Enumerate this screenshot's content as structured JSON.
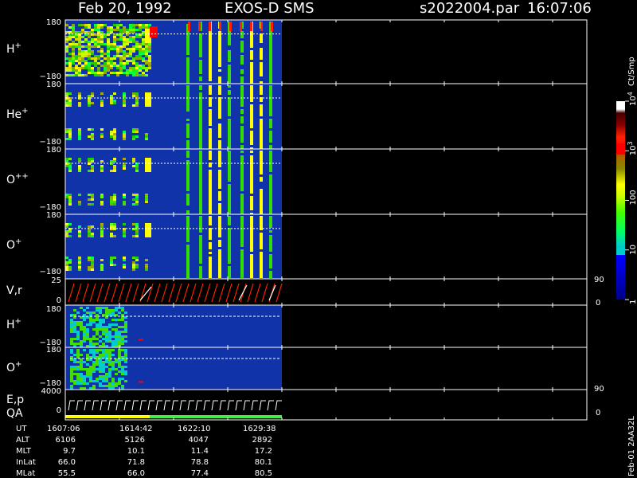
{
  "header": {
    "date": "Feb 20, 1992",
    "instrument": "EXOS-D SMS",
    "file": "s2022004.par",
    "time": "16:07:06"
  },
  "colorbar": {
    "unit": "Ct/Smp",
    "ticks": [
      {
        "label": "1",
        "value": 1
      },
      {
        "label": "10",
        "value": 10
      },
      {
        "label": "100",
        "value": 100
      },
      {
        "label": "10",
        "sup": "3",
        "value": 1000
      },
      {
        "label": "10",
        "sup": "4",
        "value": 10000
      }
    ],
    "colors": [
      "#0000ff",
      "#0011cc",
      "#00aacc",
      "#00ffff",
      "#00ffaa",
      "#00ff44",
      "#22ff00",
      "#88ff00",
      "#ffff00",
      "#cccc00",
      "#aaaa00",
      "#887700",
      "#aa6600",
      "#ff0000",
      "#cc0000",
      "#990000",
      "#770000",
      "#ffffff"
    ]
  },
  "time_axis": {
    "ticks": [
      "1607:06",
      "1614:42",
      "1622:10",
      "1629:38"
    ]
  },
  "ephemeris": [
    {
      "label": "UT",
      "values": []
    },
    {
      "label": "ALT",
      "values": [
        "6106",
        "5126",
        "4047",
        "2892"
      ]
    },
    {
      "label": "MLT",
      "values": [
        "9.7",
        "10.1",
        "11.4",
        "17.2"
      ]
    },
    {
      "label": "InLat",
      "values": [
        "66.0",
        "71.8",
        "78.8",
        "80.1"
      ]
    },
    {
      "label": "MLat",
      "values": [
        "55.5",
        "66.0",
        "77.4",
        "80.5"
      ]
    }
  ],
  "side_note": "Feb-01 2AA32L",
  "panels": {
    "hplus": {
      "label": "H",
      "sup": "+",
      "ymax": "180",
      "ymin": "−180"
    },
    "heplus": {
      "label": "He",
      "sup": "+",
      "ymax": "180",
      "ymin": "−180"
    },
    "opp": {
      "label": "O",
      "sup": "++",
      "ymax": "180",
      "ymin": "−180"
    },
    "oplus": {
      "label": "O",
      "sup": "+",
      "ymax": "180",
      "ymin": "−180"
    },
    "vr": {
      "label": "V,r",
      "ymax": "25",
      "ymin": "0",
      "rmax": "90",
      "rmin": "0"
    },
    "hplus2": {
      "label": "H",
      "sup": "+",
      "ymax": "180",
      "ymin": "−180"
    },
    "oplus2": {
      "label": "O",
      "sup": "+",
      "ymax": "180",
      "ymin": "−180"
    },
    "ep": {
      "label": "E,p",
      "label2": "QA",
      "ymax": "4000",
      "ymin": "0",
      "rmax": "90",
      "rmin": "0"
    }
  },
  "chart_data": {
    "type": "heatmap",
    "title": "Feb 20, 1992 EXOS-D SMS",
    "x": [
      "1607:06",
      "1614:42",
      "1622:10",
      "1629:38"
    ],
    "colorbar_label": "Ct/Smp",
    "colorbar_range": [
      1,
      10000
    ],
    "colorbar_scale": "log",
    "series": [
      {
        "name": "H+",
        "ylim": [
          -180,
          180
        ]
      },
      {
        "name": "He+",
        "ylim": [
          -180,
          180
        ]
      },
      {
        "name": "O++",
        "ylim": [
          -180,
          180
        ]
      },
      {
        "name": "O+",
        "ylim": [
          -180,
          180
        ]
      },
      {
        "name": "V,r",
        "ylim": [
          0,
          25
        ],
        "y2lim": [
          0,
          90
        ]
      },
      {
        "name": "H+",
        "ylim": [
          -180,
          180
        ]
      },
      {
        "name": "O+",
        "ylim": [
          -180,
          180
        ]
      },
      {
        "name": "E,p",
        "ylim": [
          0,
          4000
        ],
        "y2lim": [
          0,
          90
        ]
      }
    ],
    "grid": true
  }
}
